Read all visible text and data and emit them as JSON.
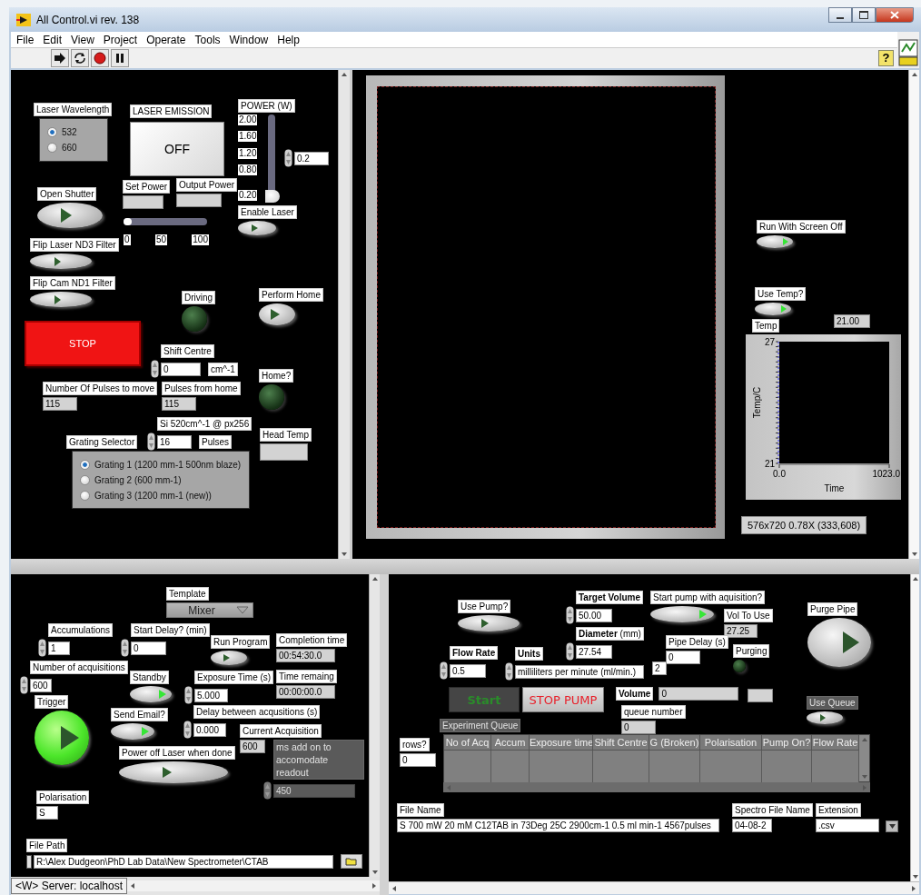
{
  "window": {
    "title": "All Control.vi rev. 138"
  },
  "menu": [
    "File",
    "Edit",
    "View",
    "Project",
    "Operate",
    "Tools",
    "Window",
    "Help"
  ],
  "toolbar": {
    "help": "?"
  },
  "laser_panel": {
    "controls": [
      {
        "kind": "radio_group",
        "label": "Laser Wavelength",
        "options": [
          {
            "label": "532",
            "selected": true
          },
          {
            "label": "660",
            "selected": false
          }
        ]
      },
      {
        "kind": "text_button",
        "label": "LASER EMISSION",
        "text": "OFF"
      },
      {
        "kind": "vslider",
        "label": "POWER (W)",
        "ticks": [
          "2.00",
          "1.60",
          "1.20",
          "0.80",
          "0.20"
        ],
        "level": 0
      },
      {
        "kind": "numeric",
        "value": "0.2",
        "spin": true
      },
      {
        "kind": "indicator",
        "label": "Set Power"
      },
      {
        "kind": "indicator",
        "label": "Output Power"
      },
      {
        "kind": "hslider",
        "ticks": [
          "0",
          "50",
          "100"
        ],
        "level": 0
      },
      {
        "kind": "toggle",
        "label": "Enable Laser",
        "on": false
      },
      {
        "kind": "toggle",
        "label": "Open Shutter",
        "on": false
      },
      {
        "kind": "toggle",
        "label": "Flip Laser ND3 Filter",
        "on": false
      },
      {
        "kind": "toggle",
        "label": "Flip Cam ND1 Filter",
        "on": false
      },
      {
        "kind": "led",
        "label": "Driving",
        "on": false
      },
      {
        "kind": "toggle",
        "label": "Perform Home",
        "on": false
      },
      {
        "kind": "stop_button",
        "text": "STOP"
      },
      {
        "kind": "numeric",
        "label": "Shift Centre",
        "value": "0",
        "spin": true,
        "unit": "cm^-1"
      },
      {
        "kind": "led",
        "label": "Home?",
        "on": false
      },
      {
        "kind": "indicator",
        "label": "Number Of Pulses to move",
        "value": "115"
      },
      {
        "kind": "indicator",
        "label": "Pulses from home",
        "value": "115"
      },
      {
        "kind": "indicator",
        "label": "Head Temp"
      },
      {
        "kind": "numeric",
        "label": "Si 520cm^-1 @ px256",
        "value": "16",
        "spin": true,
        "unit": "Pulses"
      },
      {
        "kind": "radio_group",
        "label": "Grating Selector",
        "options": [
          {
            "label": "Grating 1 (1200 mm-1 500nm blaze)",
            "selected": true
          },
          {
            "label": "Grating 2 (600 mm-1)",
            "selected": false
          },
          {
            "label": "Grating 3 (1200 mm-1 (new))",
            "selected": false
          }
        ]
      }
    ]
  },
  "camera_panel": {
    "controls": [
      {
        "kind": "image_display"
      },
      {
        "kind": "toggle",
        "label": "Run With Screen Off",
        "on": true
      },
      {
        "kind": "toggle",
        "label": "Use Temp?",
        "on": true
      },
      {
        "kind": "chart",
        "reading": "21.00",
        "chart_data": {
          "type": "line",
          "title": "Temp",
          "xlabel": "Time",
          "ylabel": "Temp/C",
          "xlim": [
            0,
            1023
          ],
          "ylim": [
            21,
            27
          ],
          "xticks": [
            {
              "value": 0,
              "label": "0.0"
            },
            {
              "value": 1023,
              "label": "1023.0"
            }
          ],
          "yticks": [
            21,
            27
          ]
        }
      },
      {
        "kind": "readout",
        "text": "576x720 0.78X    (333,608)"
      }
    ]
  },
  "acquisition_panel": {
    "controls": [
      {
        "kind": "enum",
        "label": "Template",
        "value": "Mixer"
      },
      {
        "kind": "numeric",
        "label": "Accumulations",
        "value": "1",
        "spin": true
      },
      {
        "kind": "numeric",
        "label": "Start Delay? (min)",
        "value": "0",
        "spin": true
      },
      {
        "kind": "toggle",
        "label": "Run Program",
        "on": false
      },
      {
        "kind": "indicator",
        "label": "Completion time",
        "value": "00:54:30.0"
      },
      {
        "kind": "numeric",
        "label": "Number of acquisitions",
        "value": "600",
        "spin": true
      },
      {
        "kind": "toggle",
        "label": "Standby",
        "on": true
      },
      {
        "kind": "numeric",
        "label": "Exposure Time (s)",
        "value": "5.000",
        "spin": true
      },
      {
        "kind": "indicator",
        "label": "Time remaing",
        "value": "00:00:00.0"
      },
      {
        "kind": "round_button",
        "label": "Trigger",
        "on": true
      },
      {
        "kind": "toggle",
        "label": "Send Email?",
        "on": true
      },
      {
        "kind": "numeric",
        "label": "Delay between acqusitions (s)",
        "value": "0.000",
        "spin": true
      },
      {
        "kind": "indicator",
        "label": "Current Acquisition",
        "value": "600"
      },
      {
        "kind": "toggle",
        "label": "Power off Laser when done",
        "on": false
      },
      {
        "kind": "numeric",
        "label": "ms add on to accomodate readout",
        "value": "450",
        "spin": true,
        "disabled": true
      },
      {
        "kind": "string",
        "label": "Polarisation",
        "value": "S"
      },
      {
        "kind": "path",
        "label": "File Path",
        "value": "R:\\Alex Dudgeon\\PhD Lab Data\\New Spectrometer\\CTAB"
      }
    ]
  },
  "pump_panel": {
    "controls": [
      {
        "kind": "toggle",
        "label": "Use Pump?",
        "on": false
      },
      {
        "kind": "numeric",
        "label": "Target Volume",
        "bold": true,
        "value": "50.00",
        "spin": true
      },
      {
        "kind": "toggle",
        "label": "Start pump with aquisition?",
        "on": true
      },
      {
        "kind": "indicator",
        "label": "Vol To Use",
        "value": "27.25"
      },
      {
        "kind": "round_button",
        "label": "Purge Pipe",
        "on": false
      },
      {
        "kind": "numeric",
        "label": "**Diameter** (mm)",
        "value": "27.54",
        "spin": true
      },
      {
        "kind": "numeric",
        "label": "Flow Rate",
        "bold": true,
        "value": "0.5",
        "spin": true
      },
      {
        "kind": "ring",
        "label": "Units",
        "bold": true,
        "value": "milliliters per minute (ml/min.)"
      },
      {
        "kind": "numeric",
        "value": "2",
        "spin": false
      },
      {
        "kind": "numeric",
        "label": "Pipe Delay (s)",
        "value": "0",
        "spin": false
      },
      {
        "kind": "led",
        "label": "Purging",
        "on": false
      },
      {
        "kind": "go_button",
        "text": "Start",
        "disabled": true
      },
      {
        "kind": "halt_button",
        "text": "STOP PUMP",
        "disabled": false
      },
      {
        "kind": "indicator",
        "label": "Volume",
        "bold": true,
        "value": "0"
      },
      {
        "kind": "indicator"
      },
      {
        "kind": "indicator",
        "label": "queue number",
        "value": "0"
      },
      {
        "kind": "toggle",
        "label": "Use Queue",
        "on": false,
        "disabled": true
      },
      {
        "kind": "label",
        "text": "Experiment Queue",
        "disabled": true
      },
      {
        "kind": "numeric",
        "label": "rows?",
        "value": "0",
        "spin": false
      },
      {
        "kind": "table",
        "columns": [
          "No of Acq",
          "Accum",
          "Exposure time",
          "Shift Centre",
          "G (Broken)",
          "Polarisation",
          "Pump On?",
          "Flow Rate"
        ]
      },
      {
        "kind": "string",
        "label": "File Name",
        "value": "S 700 mW 20 mM C12TAB in 73Deg 25C 2900cm-1 0.5 ml min-1 4567pulses"
      },
      {
        "kind": "string",
        "label": "Spectro File Name",
        "value": "04-08-2"
      },
      {
        "kind": "string",
        "label": "Extension",
        "value": ".csv"
      },
      {
        "kind": "menu_button"
      }
    ]
  },
  "status_bar": {
    "server": "<W> Server: localhost"
  }
}
